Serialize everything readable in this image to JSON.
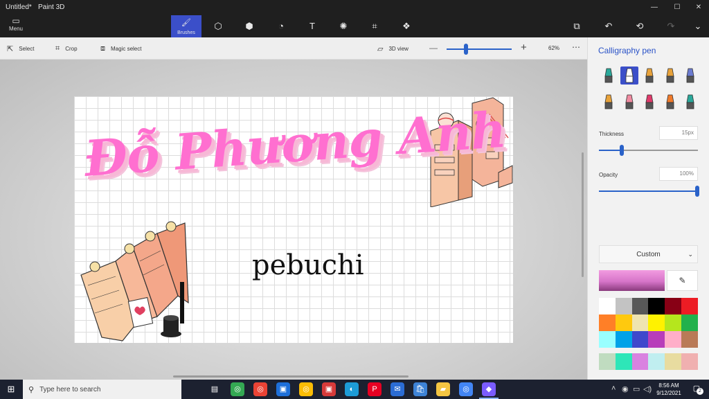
{
  "window": {
    "document_title": "Untitled*",
    "app_name": "Paint 3D",
    "controls": {
      "minimize": "—",
      "maximize": "☐",
      "close": "✕"
    }
  },
  "menu": {
    "label": "Menu",
    "icon": "folder-icon"
  },
  "tool_tabs": [
    {
      "name": "brushes",
      "label": "Brushes",
      "icon": "brush-icon",
      "active": true
    },
    {
      "name": "2d-shapes",
      "label": "",
      "icon": "2d-shapes-icon"
    },
    {
      "name": "3d-shapes",
      "label": "",
      "icon": "3d-cube-icon"
    },
    {
      "name": "stickers",
      "label": "",
      "icon": "sticker-icon"
    },
    {
      "name": "text",
      "label": "",
      "icon": "text-icon"
    },
    {
      "name": "effects",
      "label": "",
      "icon": "effects-icon"
    },
    {
      "name": "canvas",
      "label": "",
      "icon": "canvas-icon"
    },
    {
      "name": "3d-library",
      "label": "",
      "icon": "3d-library-icon"
    }
  ],
  "right_tools": [
    "paste-icon",
    "undo-icon",
    "history-icon",
    "redo-icon",
    "chevron-down-icon"
  ],
  "toolbar": {
    "select_label": "Select",
    "crop_label": "Crop",
    "magic_select_label": "Magic select",
    "view_3d_label": "3D view",
    "zoom_level": "62%",
    "zoom_fraction": 0.3
  },
  "canvas": {
    "title_text": "Đỗ Phương Anh",
    "subtitle_text": "pebuchi"
  },
  "panel": {
    "title": "Calligraphy pen",
    "brushes": [
      {
        "name": "marker",
        "icon": "marker-icon",
        "color": "#2aa89a"
      },
      {
        "name": "calligraphy-pen",
        "icon": "calligraphy-pen-icon",
        "color": "#ffffff",
        "selected": true
      },
      {
        "name": "oil-brush",
        "icon": "oil-brush-icon",
        "color": "#e8a23a"
      },
      {
        "name": "watercolor",
        "icon": "watercolor-icon",
        "color": "#e8a23a"
      },
      {
        "name": "pixel-pen",
        "icon": "pixel-pen-icon",
        "color": "#6b7bd0"
      },
      {
        "name": "pencil",
        "icon": "pencil-icon",
        "color": "#e8a23a"
      },
      {
        "name": "eraser",
        "icon": "eraser-icon",
        "color": "#f08aa0"
      },
      {
        "name": "crayon",
        "icon": "crayon-icon",
        "color": "#e03a6a"
      },
      {
        "name": "spray-can",
        "icon": "spray-can-icon",
        "color": "#f07a2a"
      },
      {
        "name": "fill",
        "icon": "fill-bucket-icon",
        "color": "#2aa89a"
      }
    ],
    "thickness_label": "Thickness",
    "thickness_value": "15px",
    "thickness_fraction": 0.23,
    "opacity_label": "Opacity",
    "opacity_value": "100%",
    "opacity_fraction": 1.0,
    "color_mode": "Custom",
    "current_color": "#e47fd2",
    "palette": [
      "#ffffff",
      "#c3c3c3",
      "#585858",
      "#000000",
      "#880015",
      "#ed1c24",
      "#ff7f27",
      "#ffc90e",
      "#efe4b0",
      "#fff200",
      "#b5e61d",
      "#22b14c",
      "#99ffff",
      "#00a2e8",
      "#3f48cc",
      "#b83dba",
      "#ffaec9",
      "#b97a57"
    ],
    "custom_palette": [
      "#c0dcc0",
      "#2ee6b8",
      "#d982e0",
      "#c0eef0",
      "#e8dca0",
      "#f0b0b0"
    ]
  },
  "taskbar": {
    "search_placeholder": "Type here to search",
    "apps": [
      {
        "name": "task-view",
        "icon": "task-view-icon",
        "color": "#1c2130"
      },
      {
        "name": "chrome-1",
        "icon": "chrome-icon",
        "color": "#34a853"
      },
      {
        "name": "chrome-2",
        "icon": "chrome-icon",
        "color": "#ea4335"
      },
      {
        "name": "app-blue",
        "icon": "app-icon",
        "color": "#1e6fd9"
      },
      {
        "name": "chrome-3",
        "icon": "chrome-icon",
        "color": "#fbbc05"
      },
      {
        "name": "app-red",
        "icon": "app-icon",
        "color": "#d63a3a"
      },
      {
        "name": "edge",
        "icon": "edge-icon",
        "color": "#1d9bd7"
      },
      {
        "name": "pinterest",
        "icon": "pinterest-icon",
        "color": "#e60023"
      },
      {
        "name": "mail",
        "icon": "mail-icon",
        "color": "#2b6cd4"
      },
      {
        "name": "store",
        "icon": "store-icon",
        "color": "#3d82d6"
      },
      {
        "name": "explorer",
        "icon": "folder-icon",
        "color": "#f4c542"
      },
      {
        "name": "chrome-4",
        "icon": "chrome-icon",
        "color": "#4285f4"
      },
      {
        "name": "paint-3d",
        "icon": "paint-3d-icon",
        "color": "#7a5cff",
        "active": true
      }
    ],
    "time": "8:56 AM",
    "date": "9/12/2021",
    "notification_count": "2"
  }
}
